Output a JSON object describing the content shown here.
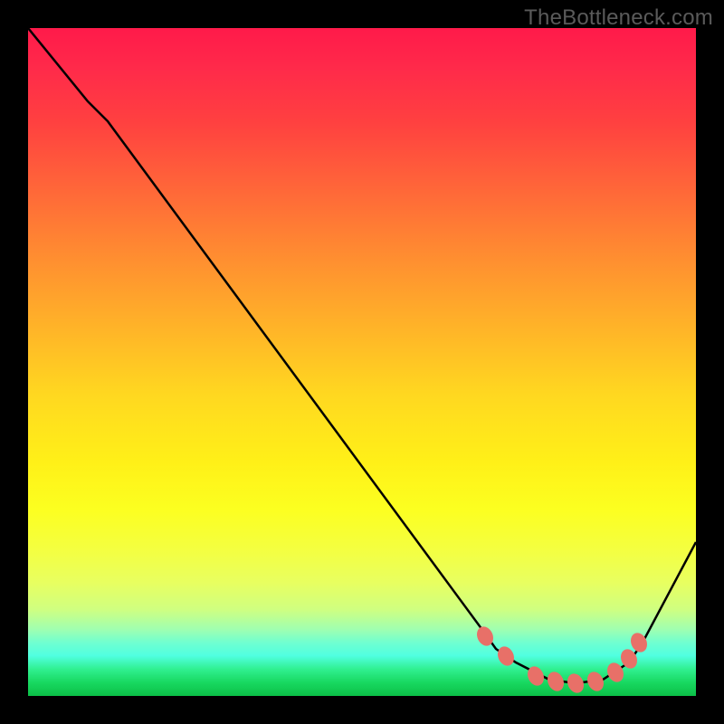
{
  "watermark": "TheBottleneck.com",
  "chart_data": {
    "type": "line",
    "title": "",
    "xlabel": "",
    "ylabel": "",
    "xlim": [
      0,
      100
    ],
    "ylim": [
      0,
      100
    ],
    "series": [
      {
        "name": "curve",
        "x": [
          0,
          9,
          12,
          68,
          70,
          73,
          78,
          82,
          86,
          90,
          92,
          100
        ],
        "y": [
          100,
          89,
          86,
          10,
          7,
          5,
          2.5,
          2,
          2.5,
          5,
          8,
          23
        ]
      }
    ],
    "markers": {
      "name": "points",
      "color": "#e87068",
      "x": [
        68.5,
        71.5,
        76,
        79,
        82,
        85,
        88,
        90,
        91.5
      ],
      "y": [
        9,
        6,
        3,
        2.2,
        2,
        2.2,
        3.5,
        5.5,
        8
      ]
    },
    "colors": {
      "background_gradient_top": "#ff1a4a",
      "background_gradient_mid": "#fff018",
      "background_gradient_bottom": "#0cc048",
      "curve": "#000000",
      "marker": "#e87068",
      "frame": "#000000"
    }
  }
}
